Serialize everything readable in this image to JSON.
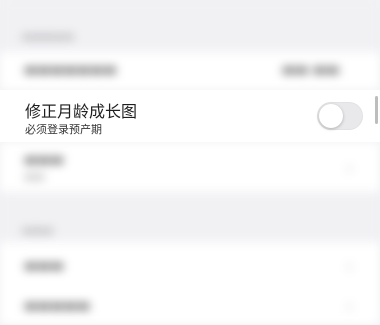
{
  "settings": {
    "growth_chart_row": {
      "title": "修正月龄成长图",
      "subtitle": "必须登录预产期",
      "toggle_on": false
    }
  }
}
